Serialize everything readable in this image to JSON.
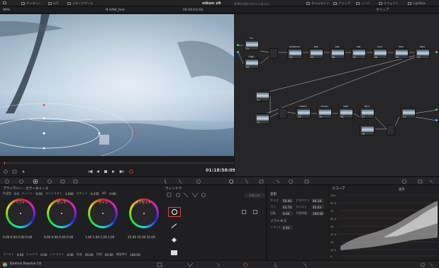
{
  "topbar": {
    "zoom": "99%",
    "gallery": "ギャラリー",
    "lut": "LUT",
    "media_pool": "メディアプール",
    "project": "nikon z9",
    "saved_status": "変更が保存されていません",
    "timeline": "タイムライン",
    "clips": "クリップ",
    "nodes": "ノード",
    "effects": "エフェクト",
    "lightbox": "Lightbox"
  },
  "viewer": {
    "zoom": "99%",
    "clip_name": "N-RAW_test",
    "timecode_in": "00:00:03:44",
    "timecode": "01:18:58:09"
  },
  "nodes_panel": {
    "clip_mode": "クリップ",
    "nodes": [
      {
        "label": "fix",
        "num": "01"
      },
      {
        "label": "high",
        "num": "02"
      },
      {
        "label": "balance",
        "num": "04"
      },
      {
        "label": "sat",
        "num": "05"
      },
      {
        "label": "sat",
        "num": "06"
      },
      {
        "label": "sat",
        "num": "07"
      },
      {
        "label": "con",
        "num": "08"
      },
      {
        "label": "des",
        "num": "09"
      },
      {
        "label": "lock",
        "num": "10"
      },
      {
        "label": "black",
        "num": "14"
      },
      {
        "label": "sharp",
        "num": "15"
      },
      {
        "label": "soft",
        "num": "16"
      },
      {
        "label": "blur",
        "num": "17"
      },
      {
        "label": "",
        "num": "18"
      },
      {
        "label": "",
        "num": "11"
      },
      {
        "label": "",
        "num": "12"
      },
      {
        "label": "",
        "num": "13"
      }
    ]
  },
  "color_wheels": {
    "title": "プライマリー - カラーホイール",
    "params": [
      {
        "label": "コントラスト",
        "value": "1.000"
      },
      {
        "label": "ピボット",
        "value": "0.435"
      },
      {
        "label": "MD",
        "value": "0.00"
      },
      {
        "label": "色温度",
        "value": "0.0"
      },
      {
        "label": "ティント",
        "value": "0.00"
      }
    ],
    "wheels": [
      {
        "name": "リフト",
        "values": "0.00  0.00  0.00  0.00"
      },
      {
        "name": "ガンマ",
        "values": "0.00  0.00  0.00  0.00"
      },
      {
        "name": "ゲイン",
        "values": "1.00  1.00  1.00  1.00"
      },
      {
        "name": "オフセット",
        "values": "25.00  25.00  25.00"
      }
    ],
    "footer": [
      {
        "label": "ブースト",
        "value": "0.00"
      },
      {
        "label": "シャドウ",
        "value": "0.00"
      },
      {
        "label": "ハイライト",
        "value": "0.00"
      },
      {
        "label": "彩度",
        "value": "50.00"
      },
      {
        "label": "色相",
        "value": "50.00"
      },
      {
        "label": "輝度MIX",
        "value": "100.00"
      }
    ]
  },
  "window_panel": {
    "title": "ウィンドウ",
    "reset": "リセット"
  },
  "sizing": {
    "title": "変形",
    "rows": [
      {
        "l1": "サイズ",
        "v1": "50.00",
        "l2": "アスペクト",
        "v2": "84.18"
      },
      {
        "l1": "パン",
        "v1": "42.74",
        "l2": "ティルト",
        "v2": "45.63"
      },
      {
        "l1": "回転",
        "v1": "0.00",
        "l2": "不透明度",
        "v2": "100.00"
      }
    ],
    "softness_title": "ソフトネス",
    "soft_label": "ソフト1",
    "soft_value": "5.93"
  },
  "scope": {
    "title": "スコープ",
    "mode": "波形",
    "scale": [
      "100",
      "87.5",
      "75",
      "62.5",
      "50",
      "37.5",
      "25",
      "12.5",
      "0"
    ]
  },
  "footer": {
    "app_name": "DaVinci Resolve 18"
  }
}
